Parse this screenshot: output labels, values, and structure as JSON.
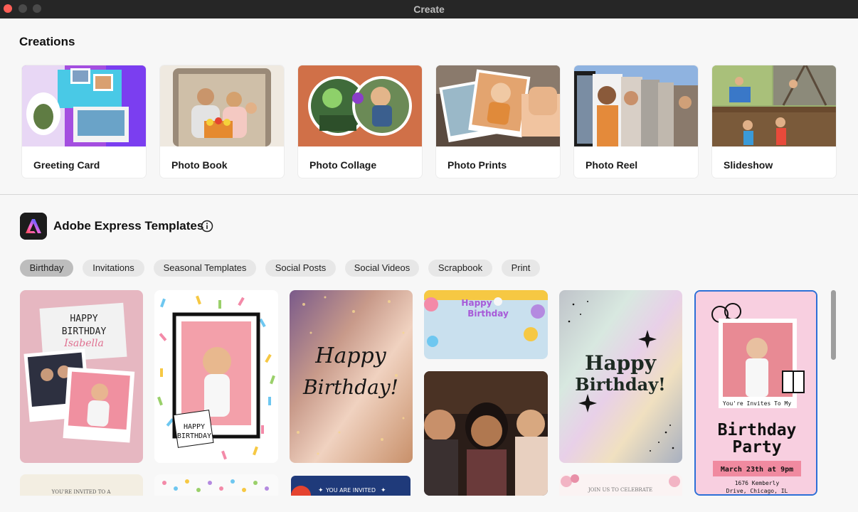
{
  "window": {
    "title": "Create"
  },
  "creations": {
    "title": "Creations",
    "items": [
      {
        "label": "Greeting Card"
      },
      {
        "label": "Photo Book"
      },
      {
        "label": "Photo Collage"
      },
      {
        "label": "Photo Prints"
      },
      {
        "label": "Photo Reel"
      },
      {
        "label": "Slideshow"
      }
    ]
  },
  "express": {
    "title": "Adobe Express Templates",
    "info_icon": "info-icon",
    "chips": [
      {
        "label": "Birthday",
        "selected": true
      },
      {
        "label": "Invitations",
        "selected": false
      },
      {
        "label": "Seasonal Templates",
        "selected": false
      },
      {
        "label": "Social Posts",
        "selected": false
      },
      {
        "label": "Social Videos",
        "selected": false
      },
      {
        "label": "Scrapbook",
        "selected": false
      },
      {
        "label": "Print",
        "selected": false
      }
    ]
  },
  "templates": {
    "t1": {
      "line1": "HAPPY",
      "line2": "BIRTHDAY",
      "name": "Isabella"
    },
    "t2": {
      "line1": "HAPPY",
      "line2": "BIRTHDAY"
    },
    "t3": {
      "line1": "Happy",
      "line2": "Birthday!"
    },
    "t4": {
      "line1": "Happy",
      "line2": "Birthday"
    },
    "t6": {
      "line1": "Happy",
      "line2": "Birthday!"
    },
    "t7": {
      "subtitle": "You're Invites To My",
      "line1": "Birthday",
      "line2": "Party",
      "date": "March 23th at 9pm",
      "addr1": "1676 Kemberly",
      "addr2": "Drive, Chicago, IL"
    },
    "b1": {
      "text": "YOU'RE INVITED TO A"
    },
    "b3": {
      "text": "YOU ARE INVITED"
    },
    "b5": {
      "text": "JOIN US TO CELEBRATE"
    }
  },
  "colors": {
    "selected_border": "#2c6fd6",
    "chip_bg": "#e7e7e7",
    "chip_active_bg": "#bdbdbd",
    "accent_pink": "#f08aa0"
  }
}
